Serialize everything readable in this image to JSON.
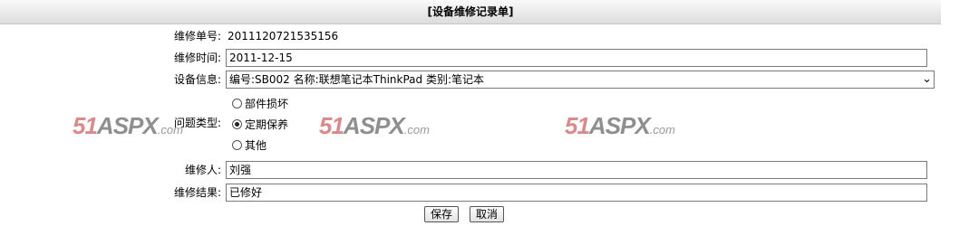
{
  "header": {
    "title": "[设备维修记录单]"
  },
  "form": {
    "order_no_label": "维修单号:",
    "order_no_value": "2011120721535156",
    "date_label": "维修时间:",
    "date_value": "2011-12-15",
    "device_label": "设备信息:",
    "device_value": "编号:SB002 名称:联想笔记本ThinkPad 类别:笔记本",
    "issue_type_label": "问题类型:",
    "issue_options": [
      {
        "label": "部件损坏",
        "checked": false
      },
      {
        "label": "定期保养",
        "checked": true
      },
      {
        "label": "其他",
        "checked": false
      }
    ],
    "repairer_label": "维修人:",
    "repairer_value": "刘强",
    "result_label": "维修结果:",
    "result_value": "已修好"
  },
  "buttons": {
    "save": "保存",
    "cancel": "取消"
  },
  "watermark": {
    "num": "51",
    "aspx": "ASPX",
    "com": ".com"
  }
}
